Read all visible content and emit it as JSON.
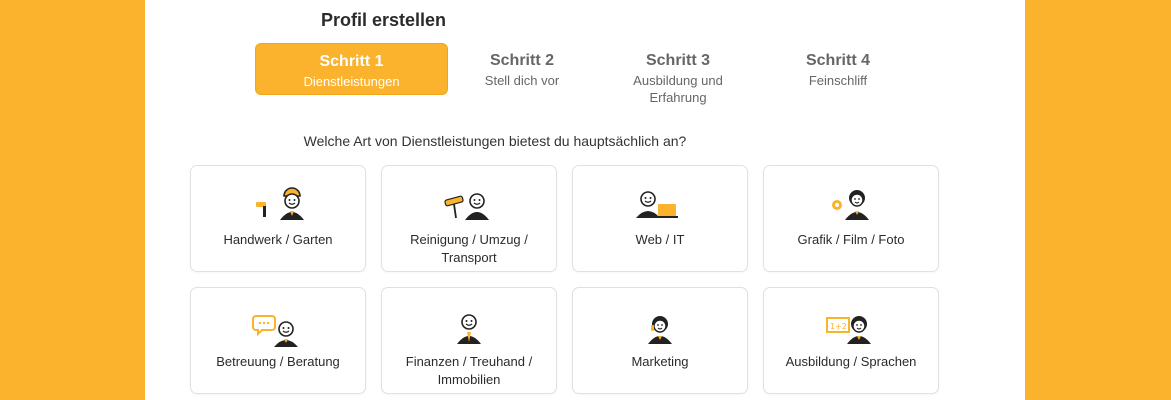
{
  "title": "Profil erstellen",
  "steps": [
    {
      "title": "Schritt 1",
      "sub": "Dienstleistungen"
    },
    {
      "title": "Schritt 2",
      "sub": "Stell dich vor"
    },
    {
      "title": "Schritt 3",
      "sub": "Ausbildung und Erfahrung"
    },
    {
      "title": "Schritt 4",
      "sub": "Feinschliff"
    }
  ],
  "question": "Welche Art von Dienstleistungen bietest du hauptsächlich an?",
  "categories": [
    {
      "label": "Handwerk / Garten",
      "icon": "construction-worker-icon"
    },
    {
      "label": "Reinigung / Umzug / Transport",
      "icon": "cleaning-icon"
    },
    {
      "label": "Web / IT",
      "icon": "laptop-user-icon"
    },
    {
      "label": "Grafik / Film / Foto",
      "icon": "designer-icon"
    },
    {
      "label": "Betreuung / Beratung",
      "icon": "consulting-icon"
    },
    {
      "label": "Finanzen / Treuhand / Immobilien",
      "icon": "finance-person-icon"
    },
    {
      "label": "Marketing",
      "icon": "marketing-headset-icon"
    },
    {
      "label": "Ausbildung / Sprachen",
      "icon": "teacher-board-icon"
    }
  ],
  "colors": {
    "accent": "#FBB22C",
    "accent_border": "#F2A51A",
    "text": "#2b2b2b"
  }
}
